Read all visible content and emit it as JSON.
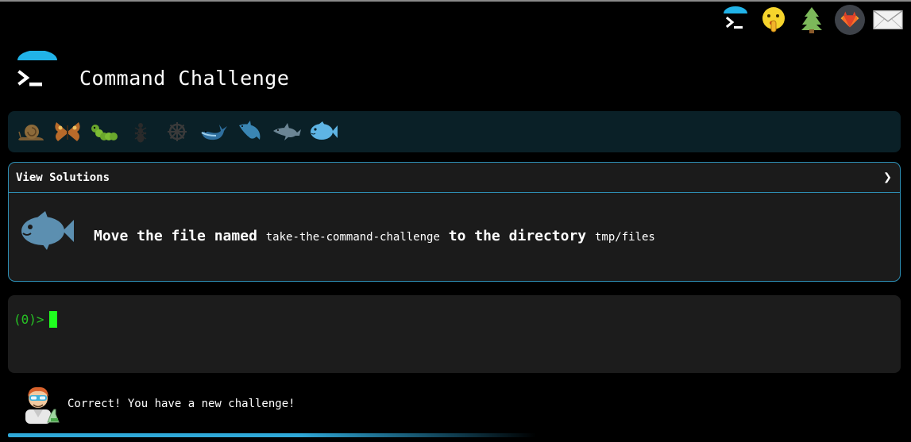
{
  "header": {
    "title": "Command Challenge"
  },
  "top_icons": [
    "terminal-icon",
    "shushing-face-icon",
    "tree-icon",
    "gitlab-icon",
    "mail-icon"
  ],
  "levels": [
    "snail",
    "butterfly",
    "caterpillar",
    "ant",
    "wheel",
    "whale",
    "shark",
    "dolphin",
    "fish"
  ],
  "challenge": {
    "solutions_label": "View Solutions",
    "chevron": "❯",
    "task_prefix": "Move the file named",
    "filename": "take-the-command-challenge",
    "task_middle": "to the directory",
    "directory": "tmp/files"
  },
  "terminal": {
    "prompt": "(0)>"
  },
  "status": {
    "message": "Correct! You have a new challenge!",
    "progress_fraction": 0.58
  },
  "colors": {
    "accent": "#2d8fb5",
    "level_bar": "#0a2027",
    "prompt": "#27c324",
    "cursor": "#1fff1f"
  }
}
